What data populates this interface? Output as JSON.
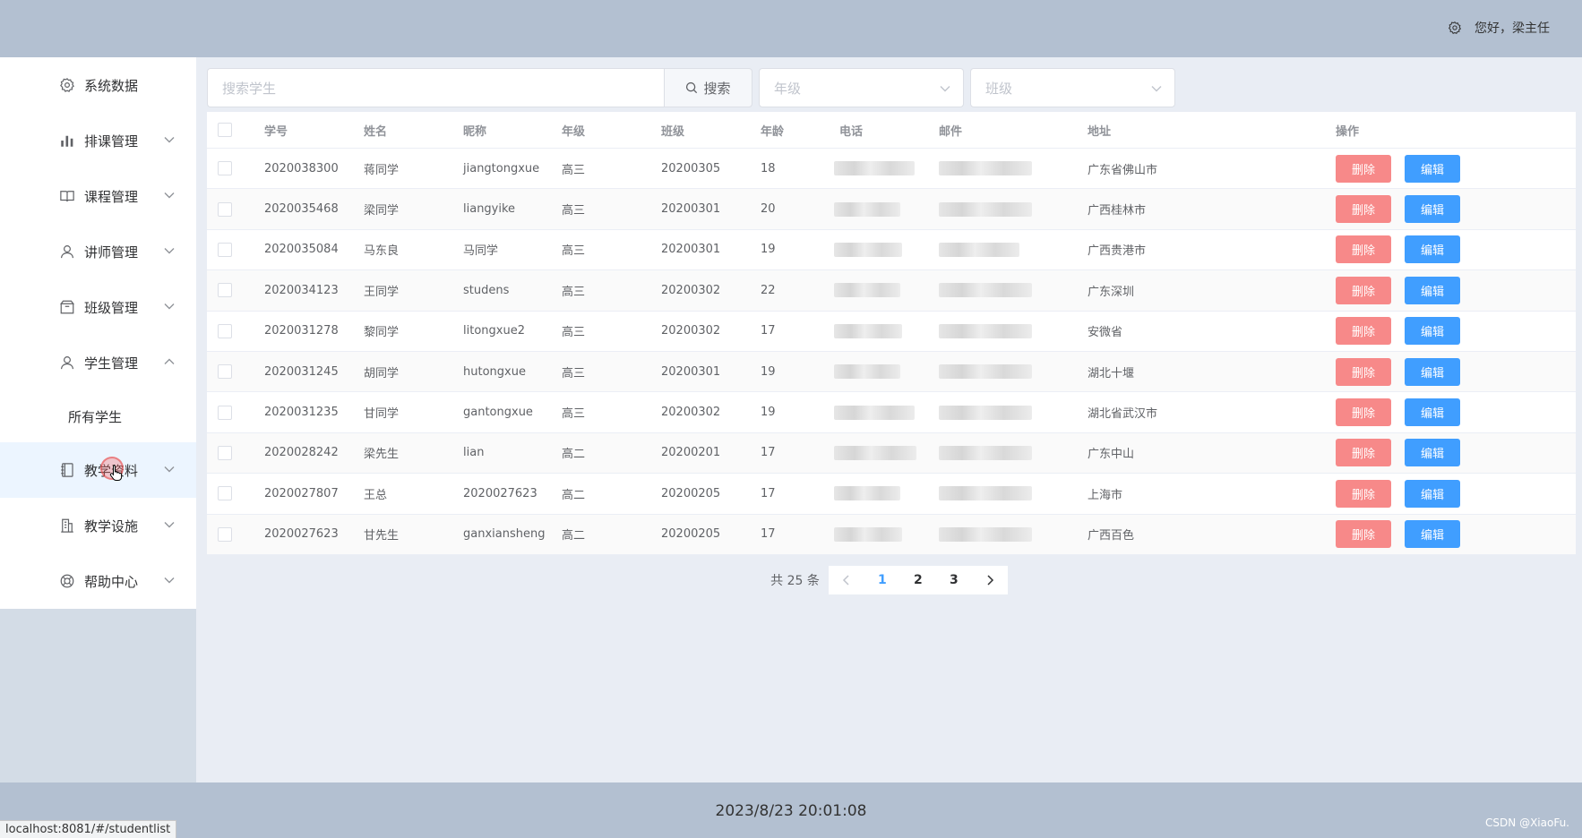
{
  "header": {
    "greeting": "您好，",
    "user_name": "梁主任",
    "icon": "gear-icon"
  },
  "sidebar": {
    "items": [
      {
        "label": "系统数据",
        "icon": "gear-icon",
        "has_chevron": false
      },
      {
        "label": "排课管理",
        "icon": "bar-chart-icon",
        "has_chevron": true
      },
      {
        "label": "课程管理",
        "icon": "book-icon",
        "has_chevron": true
      },
      {
        "label": "讲师管理",
        "icon": "user-icon",
        "has_chevron": true
      },
      {
        "label": "班级管理",
        "icon": "box-icon",
        "has_chevron": true
      },
      {
        "label": "学生管理",
        "icon": "user-icon",
        "has_chevron": true,
        "expanded": true
      },
      {
        "label": "教学资料",
        "icon": "notebook-icon",
        "has_chevron": true
      },
      {
        "label": "教学设施",
        "icon": "building-icon",
        "has_chevron": true
      },
      {
        "label": "帮助中心",
        "icon": "lifebuoy-icon",
        "has_chevron": true
      }
    ],
    "submenu": {
      "label": "所有学生"
    }
  },
  "search": {
    "placeholder": "搜索学生",
    "button_label": "搜索",
    "grade_placeholder": "年级",
    "class_placeholder": "班级"
  },
  "table": {
    "columns": [
      "学号",
      "姓名",
      "昵称",
      "年级",
      "班级",
      "年龄",
      "电话",
      "邮件",
      "地址",
      "操作"
    ],
    "delete_label": "删除",
    "edit_label": "编辑",
    "rows": [
      {
        "id": "2020038300",
        "name": "蒋同学",
        "nickname": "jiangtongxue",
        "grade": "高三",
        "class": "20200305",
        "age": "18",
        "address": "广东省佛山市"
      },
      {
        "id": "2020035468",
        "name": "梁同学",
        "nickname": "liangyike",
        "grade": "高三",
        "class": "20200301",
        "age": "20",
        "address": "广西桂林市"
      },
      {
        "id": "2020035084",
        "name": "马东良",
        "nickname": "马同学",
        "grade": "高三",
        "class": "20200301",
        "age": "19",
        "address": "广西贵港市"
      },
      {
        "id": "2020034123",
        "name": "王同学",
        "nickname": "studens",
        "grade": "高三",
        "class": "20200302",
        "age": "22",
        "address": "广东深圳"
      },
      {
        "id": "2020031278",
        "name": "黎同学",
        "nickname": "litongxue2",
        "grade": "高三",
        "class": "20200302",
        "age": "17",
        "address": "安微省"
      },
      {
        "id": "2020031245",
        "name": "胡同学",
        "nickname": "hutongxue",
        "grade": "高三",
        "class": "20200301",
        "age": "19",
        "address": "湖北十堰"
      },
      {
        "id": "2020031235",
        "name": "甘同学",
        "nickname": "gantongxue",
        "grade": "高三",
        "class": "20200302",
        "age": "19",
        "address": "湖北省武汉市"
      },
      {
        "id": "2020028242",
        "name": "梁先生",
        "nickname": "lian",
        "grade": "高二",
        "class": "20200201",
        "age": "17",
        "address": "广东中山"
      },
      {
        "id": "2020027807",
        "name": "王总",
        "nickname": "2020027623",
        "grade": "高二",
        "class": "20200205",
        "age": "17",
        "address": "上海市"
      },
      {
        "id": "2020027623",
        "name": "甘先生",
        "nickname": "ganxiansheng",
        "grade": "高二",
        "class": "20200205",
        "age": "17",
        "address": "广西百色"
      }
    ]
  },
  "pagination": {
    "total_text": "共 25 条",
    "pages": [
      "1",
      "2",
      "3"
    ],
    "current_page": "1"
  },
  "footer": {
    "datetime": "2023/8/23 20:01:08",
    "watermark": "CSDN @XiaoFu."
  },
  "status_bar": {
    "url": "localhost:8081/#/studentlist"
  },
  "colors": {
    "header_bg": "#b3c0d1",
    "delete_btn": "#f78989",
    "edit_btn": "#409eff",
    "active_page": "#409eff"
  }
}
